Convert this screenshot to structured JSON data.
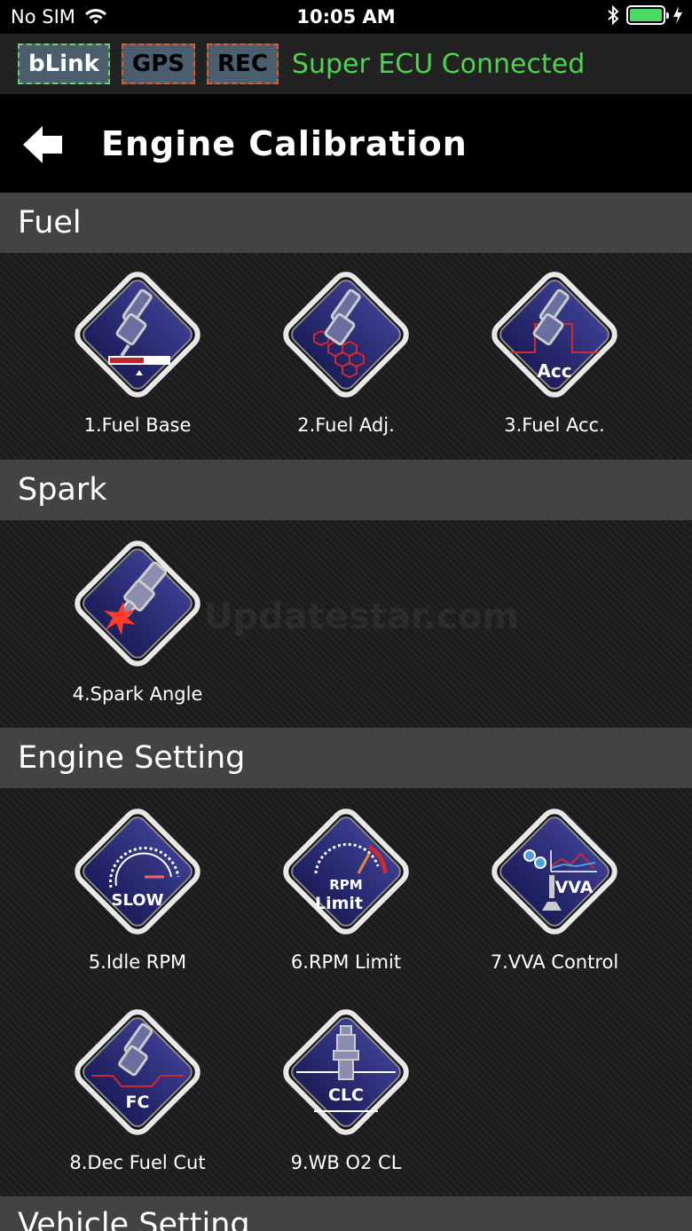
{
  "status_bar": {
    "carrier": "No SIM",
    "time": "10:05 AM"
  },
  "connection": {
    "tags": [
      "bLink",
      "GPS",
      "REC"
    ],
    "status_text": "Super ECU Connected",
    "status_color": "#4ed34e"
  },
  "header": {
    "title": "Engine Calibration"
  },
  "sections": {
    "fuel": {
      "title": "Fuel",
      "items": [
        {
          "label": "1.Fuel Base",
          "icon": "fuel-base-icon"
        },
        {
          "label": "2.Fuel Adj.",
          "icon": "fuel-adj-icon"
        },
        {
          "label": "3.Fuel Acc.",
          "icon": "fuel-acc-icon",
          "icon_text": "Acc"
        }
      ]
    },
    "spark": {
      "title": "Spark",
      "items": [
        {
          "label": "4.Spark Angle",
          "icon": "spark-angle-icon"
        }
      ]
    },
    "engine_setting": {
      "title": "Engine Setting",
      "items": [
        {
          "label": "5.Idle RPM",
          "icon": "idle-rpm-icon",
          "icon_text": "SLOW"
        },
        {
          "label": "6.RPM Limit",
          "icon": "rpm-limit-icon",
          "icon_text": "RPM",
          "icon_text2": "Limit"
        },
        {
          "label": "7.VVA Control",
          "icon": "vva-control-icon",
          "icon_text": "VVA"
        },
        {
          "label": "8.Dec Fuel Cut",
          "icon": "dec-fuel-cut-icon",
          "icon_text": "FC"
        },
        {
          "label": "9.WB O2 CL",
          "icon": "wb-o2-cl-icon",
          "icon_text": "CLC"
        }
      ]
    },
    "vehicle_setting": {
      "title": "Vehicle Setting"
    }
  },
  "watermark": "Updatestar.com",
  "colors": {
    "diamond_fill": "#27296e",
    "diamond_border": "#e8e8e8",
    "accent_red": "#d0282e",
    "section_bg": "#434343"
  }
}
